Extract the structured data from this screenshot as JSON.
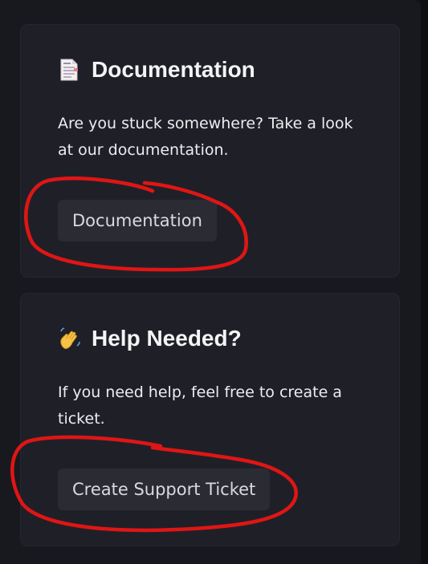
{
  "documentation_card": {
    "icon": "page-facing-up-icon",
    "title": "Documentation",
    "description": "Are you stuck somewhere? Take a look at our documentation.",
    "button_label": "Documentation"
  },
  "help_card": {
    "icon": "waving-hand-icon",
    "title": "Help Needed?",
    "description": "If you need help, feel free to create a ticket.",
    "button_label": "Create Support Ticket"
  },
  "colors": {
    "background": "#18191e",
    "card": "#1f2027",
    "button": "#2b2c33",
    "annotation": "#e01515"
  }
}
